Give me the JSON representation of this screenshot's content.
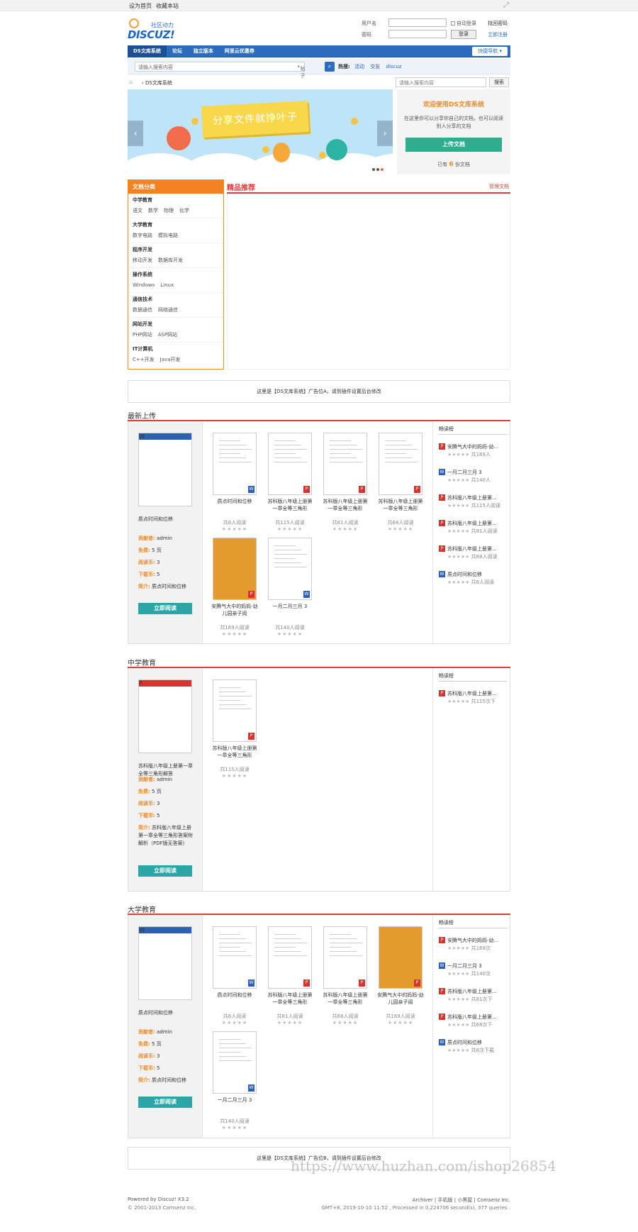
{
  "topbar": {
    "set_home": "设为首页",
    "favorite": "收藏本站"
  },
  "logo": {
    "sub": "社区动力",
    "brand": "DISCUZ!"
  },
  "login": {
    "user_label": "用户名",
    "pwd_label": "密码",
    "auto_login": "自动登录",
    "find_pwd": "找回密码",
    "login_btn": "登录",
    "register": "立即注册"
  },
  "nav": {
    "items": [
      "DS文库系统",
      "论坛",
      "独立版本",
      "阿里云优惠券"
    ],
    "quick": "快捷导航"
  },
  "search": {
    "placeholder": "请输入搜索内容",
    "type": "帖子",
    "hot_label": "热搜:",
    "hot": [
      "活动",
      "交友",
      "discuz"
    ]
  },
  "crumb": {
    "text": "DS文库系统",
    "search_placeholder": "请输入搜索内容",
    "search_btn": "搜索"
  },
  "banner": {
    "slogan": "分享文件就挣叶子"
  },
  "welcome": {
    "title": "欢迎使用DS文库系统",
    "desc": "在这里你可以分享你自己的文档，也可以阅读别人分享的文档",
    "upload": "上传文档",
    "count_pre": "已有",
    "count": "6",
    "count_post": "份文档"
  },
  "categories": {
    "title": "文档分类",
    "groups": [
      {
        "name": "中学教育",
        "items": [
          "语文",
          "数学",
          "物理",
          "化学"
        ]
      },
      {
        "name": "大学教育",
        "items": [
          "数字电路",
          "模拟电路"
        ]
      },
      {
        "name": "程序开发",
        "items": [
          "移动开发",
          "数据库开发"
        ]
      },
      {
        "name": "操作系统",
        "items": [
          "Windows",
          "Linux"
        ]
      },
      {
        "name": "通信技术",
        "items": [
          "数据通信",
          "网络通信"
        ]
      },
      {
        "name": "网站开发",
        "items": [
          "PHP网站",
          "ASP网站"
        ]
      },
      {
        "name": "IT计算机",
        "items": [
          "C++开发",
          "Java开发"
        ]
      }
    ]
  },
  "featured": {
    "title": "精品推荐",
    "manage": "管理文档"
  },
  "ads": {
    "a": "这里是【DS文库系统】广告位A，请到插件设置后台修改",
    "b": "这里是【DS文库系统】广告位B，请到插件设置后台修改"
  },
  "labels": {
    "contributor": "贡献者:",
    "free": "免费:",
    "read_coin": "阅读币:",
    "download_coin": "下载币:",
    "intro": "简介:",
    "read_now": "立即阅读",
    "rank_title": "畅读榜",
    "stars": "★★★★★"
  },
  "sections": [
    {
      "title": "最新上传",
      "main": {
        "name": "质点时间和位移",
        "contributor": "admin",
        "pages": "5 页",
        "read": "3",
        "download": "5",
        "intro": "质点时间和位移"
      },
      "docs": [
        {
          "name": "质点时间和位移",
          "reads": "共6人阅读",
          "type": "W"
        },
        {
          "name": "苏科版八年级上册第一章全等三角形",
          "reads": "共115人阅读",
          "type": "P"
        },
        {
          "name": "苏科版八年级上册第一章全等三角形",
          "reads": "共81人阅读",
          "type": "P"
        },
        {
          "name": "苏科版八年级上册第一章全等三角形",
          "reads": "共68人阅读",
          "type": "P"
        },
        {
          "name": "安腾气大中的妈妈-幼儿园亲子阅",
          "reads": "共169人阅读",
          "type": "P"
        },
        {
          "name": "一月二月三月 3",
          "reads": "共140人阅读",
          "type": "W"
        }
      ],
      "rank": [
        {
          "name": "安腾气大中的妈妈-幼...",
          "reads": "共169人",
          "type": "P"
        },
        {
          "name": "一月二月三月 3",
          "reads": "共140人",
          "type": "W"
        },
        {
          "name": "苏科版八年级上册第...",
          "reads": "共115人阅读",
          "type": "P"
        },
        {
          "name": "苏科版八年级上册第...",
          "reads": "共81人阅读",
          "type": "P"
        },
        {
          "name": "苏科版八年级上册第...",
          "reads": "共68人阅读",
          "type": "P"
        },
        {
          "name": "质点时间和位移",
          "reads": "共6人阅读",
          "type": "W"
        }
      ]
    },
    {
      "title": "中学教育",
      "main": {
        "name": "苏科版八年级上册第一章全等三角形解答",
        "contributor": "admin",
        "pages": "5 页",
        "read": "3",
        "download": "5",
        "intro": "苏科版八年级上册第一章全等三角形答案附解析（PDF版无答案）"
      },
      "docs": [
        {
          "name": "苏科版八年级上册第一章全等三角形",
          "reads": "共115人阅读",
          "type": "P"
        }
      ],
      "rank": [
        {
          "name": "苏科版八年级上册第...",
          "reads": "共115次下",
          "type": "P"
        }
      ]
    },
    {
      "title": "大学教育",
      "main": {
        "name": "质点时间和位移",
        "contributor": "admin",
        "pages": "5 页",
        "read": "3",
        "download": "5",
        "intro": "质点时间和位移"
      },
      "docs": [
        {
          "name": "质点时间和位移",
          "reads": "共6人阅读",
          "type": "W"
        },
        {
          "name": "苏科版八年级上册第一章全等三角形",
          "reads": "共81人阅读",
          "type": "P"
        },
        {
          "name": "苏科版八年级上册第一章全等三角形",
          "reads": "共68人阅读",
          "type": "P"
        },
        {
          "name": "安腾气大中的妈妈-幼儿园亲子阅",
          "reads": "共169人阅读",
          "type": "P"
        },
        {
          "name": "一月二月三月 3",
          "reads": "共140人阅读",
          "type": "W"
        }
      ],
      "rank": [
        {
          "name": "安腾气大中的妈妈-幼...",
          "reads": "共169次",
          "type": "P"
        },
        {
          "name": "一月二月三月 3",
          "reads": "共140次",
          "type": "W"
        },
        {
          "name": "苏科版八年级上册第...",
          "reads": "共81次下",
          "type": "P"
        },
        {
          "name": "苏科版八年级上册第...",
          "reads": "共68次下",
          "type": "P"
        },
        {
          "name": "质点时间和位移",
          "reads": "共6次下载",
          "type": "W"
        }
      ]
    }
  ],
  "footer": {
    "powered": "Powered by Discuz! X3.2",
    "copyright": "© 2001-2013 Comsenz Inc.",
    "links": "Archiver | 手机版 | 小黑屋 | Comsenz Inc.",
    "time": "GMT+8, 2019-10-10 11:52 , Processed in 0.224706 second(s), 377 queries ."
  },
  "watermark": "https://www.huzhan.com/ishop26854"
}
